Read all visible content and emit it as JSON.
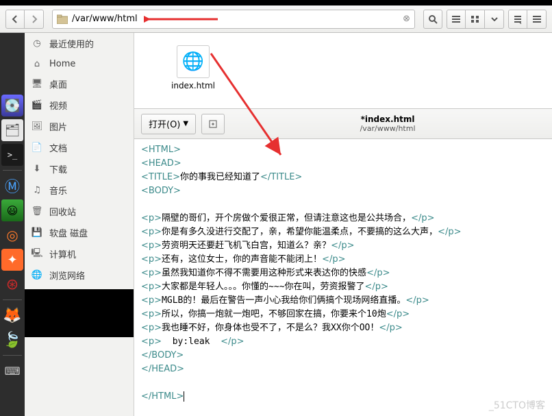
{
  "path": "/var/www/html",
  "sidebar": {
    "items": [
      {
        "icon": "clock",
        "label": "最近使用的"
      },
      {
        "icon": "home",
        "label": "Home"
      },
      {
        "icon": "desktop",
        "label": "桌面"
      },
      {
        "icon": "video",
        "label": "视频"
      },
      {
        "icon": "image",
        "label": "图片"
      },
      {
        "icon": "doc",
        "label": "文档"
      },
      {
        "icon": "download",
        "label": "下载"
      },
      {
        "icon": "music",
        "label": "音乐"
      },
      {
        "icon": "trash",
        "label": "回收站"
      },
      {
        "icon": "floppy",
        "label": "软盘 磁盘"
      },
      {
        "icon": "computer",
        "label": "计算机"
      },
      {
        "icon": "network",
        "label": "浏览网络"
      }
    ]
  },
  "file": {
    "name": "index.html"
  },
  "editor": {
    "open_label": "打开(O)",
    "title": "*index.html",
    "subtitle": "/var/www/html",
    "lines": [
      {
        "t": "tag",
        "v": "<HTML>"
      },
      {
        "t": "tag",
        "v": "<HEAD>"
      },
      {
        "t": "mix",
        "pre": "<TITLE>",
        "txt": "你的事我已经知道了",
        "post": "</TITLE>"
      },
      {
        "t": "tag",
        "v": "<BODY>"
      },
      {
        "t": "blank",
        "v": ""
      },
      {
        "t": "mix",
        "pre": "<p>",
        "txt": "隔壁的哥们，开个房做个爱很正常，但请注意这也是公共场合，",
        "post": "</p>"
      },
      {
        "t": "mix",
        "pre": "<p>",
        "txt": "你是有多久没进行交配了，亲，希望你能温柔点，不要搞的这么大声，",
        "post": "</p>"
      },
      {
        "t": "mix",
        "pre": "<p>",
        "txt": "劳资明天还要赶飞机飞白宫，知道么？亲？",
        "post": "</p>"
      },
      {
        "t": "mix",
        "pre": "<p>",
        "txt": "还有，这位女士，你的声音能不能闭上！",
        "post": "</p>"
      },
      {
        "t": "mix",
        "pre": "<p>",
        "txt": "虽然我知道你不得不需要用这种形式来表达你的快感",
        "post": "</p>"
      },
      {
        "t": "mix",
        "pre": "<p>",
        "txt": "大家都是年轻人。。。你懂的~~~你在叫，劳资报警了",
        "post": "</p>"
      },
      {
        "t": "mix",
        "pre": "<p>",
        "txt": "MGLB的！最后在警告一声小心我给你们俩搞个现场网络直播。",
        "post": "</p>"
      },
      {
        "t": "mix",
        "pre": "<p>",
        "txt": "所以，你搞一炮就一炮吧，不够回家在搞，你要来个10炮",
        "post": "</p>"
      },
      {
        "t": "mix",
        "pre": "<p>",
        "txt": "我也睡不好，你身体也受不了，不是么？我XX你个OO！",
        "post": "</p>"
      },
      {
        "t": "mix",
        "pre": "<p>",
        "txt": "  by:leak  ",
        "post": "</p>"
      },
      {
        "t": "tag",
        "v": "</BODY>"
      },
      {
        "t": "tag",
        "v": "</HEAD>"
      },
      {
        "t": "blank",
        "v": ""
      },
      {
        "t": "tagcursor",
        "v": "</HTML>"
      }
    ]
  },
  "watermark": "_51CTO博客"
}
